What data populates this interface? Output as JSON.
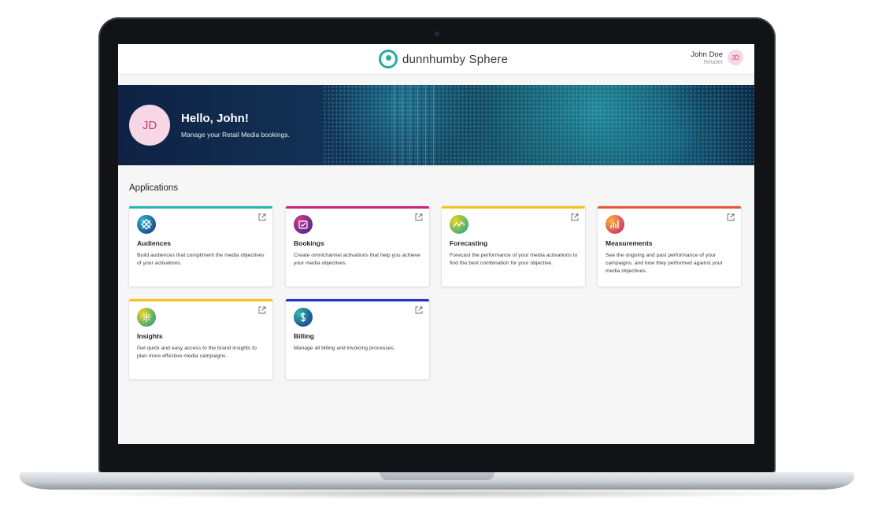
{
  "header": {
    "logo_text": "dunnhumby Sphere",
    "user_name": "John Doe",
    "user_role": "Retailer",
    "user_initials": "JD"
  },
  "hero": {
    "initials": "JD",
    "greeting": "Hello, John!",
    "subtitle": "Manage your Retail Media bookings."
  },
  "applications": {
    "title": "Applications",
    "cards": [
      {
        "title": "Audiences",
        "description": "Build audiences that compliment the media objectives of your activations.",
        "accent": "#2bb3b0",
        "icon": "audiences-icon"
      },
      {
        "title": "Bookings",
        "description": "Create omnichannel activations that help you achieve your media objectives.",
        "accent": "#c8237b",
        "icon": "bookings-icon"
      },
      {
        "title": "Forecasting",
        "description": "Forecast the performance of your media activations to find the best combination for your objective.",
        "accent": "#f2c318",
        "icon": "forecasting-icon"
      },
      {
        "title": "Measurements",
        "description": "See the ongoing and past performance of your campaigns, and how they performed against your media objectives.",
        "accent": "#e5562e",
        "icon": "measurements-icon"
      },
      {
        "title": "Insights",
        "description": "Get quick and easy access to the brand insights to plan more effective media campaigns.",
        "accent": "#f5c518",
        "icon": "insights-icon"
      },
      {
        "title": "Billing",
        "description": "Manage all billing and invoicing processes.",
        "accent": "#2038c4",
        "icon": "billing-icon"
      }
    ]
  }
}
